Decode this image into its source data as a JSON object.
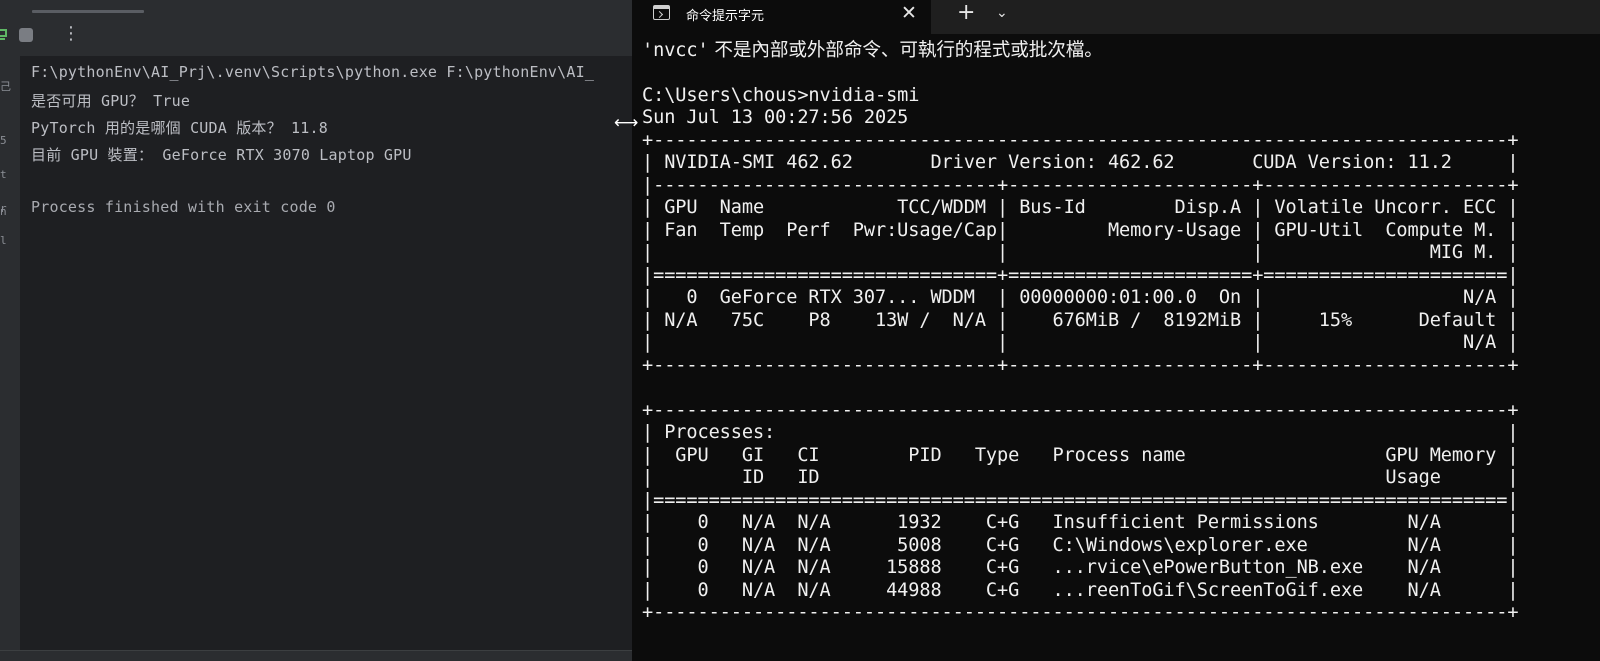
{
  "ide": {
    "gutter_chars": [
      "己",
      "5",
      "t",
      "r",
      "n",
      "l"
    ],
    "console_lines": [
      "F:\\pythonEnv\\AI_Prj\\.venv\\Scripts\\python.exe F:\\pythonEnv\\AI_",
      "是否可用 GPU？ True",
      "PyTorch 用的是哪個 CUDA 版本？ 11.8",
      "目前 GPU 裝置： GeForce RTX 3070 Laptop GPU",
      "",
      "Process finished with exit code 0"
    ],
    "toolbar": {
      "rerun_icon": "rerun-icon",
      "stop_icon": "stop-icon",
      "more_label": "⋮"
    }
  },
  "terminal": {
    "tab_title": "命令提示字元",
    "tab_close": "✕",
    "new_tab": "+",
    "dropdown": "⌄",
    "resize_cursor": "⟷",
    "nvcc_cmd": "'nvcc'",
    "nvcc_msg": " 不是內部或外部命令、可執行的程式或批次檔。",
    "lines": [
      "",
      "C:\\Users\\chous>nvidia-smi",
      "Sun Jul 13 00:27:56 2025",
      "+-----------------------------------------------------------------------------+",
      "| NVIDIA-SMI 462.62       Driver Version: 462.62       CUDA Version: 11.2     |",
      "|-------------------------------+----------------------+----------------------+",
      "| GPU  Name            TCC/WDDM | Bus-Id        Disp.A | Volatile Uncorr. ECC |",
      "| Fan  Temp  Perf  Pwr:Usage/Cap|         Memory-Usage | GPU-Util  Compute M. |",
      "|                               |                      |               MIG M. |",
      "|===============================+======================+======================|",
      "|   0  GeForce RTX 307... WDDM  | 00000000:01:00.0  On |                  N/A |",
      "| N/A   75C    P8    13W /  N/A |    676MiB /  8192MiB |     15%      Default |",
      "|                               |                      |                  N/A |",
      "+-------------------------------+----------------------+----------------------+",
      "",
      "+-----------------------------------------------------------------------------+",
      "| Processes:                                                                  |",
      "|  GPU   GI   CI        PID   Type   Process name                  GPU Memory |",
      "|        ID   ID                                                   Usage      |",
      "|=============================================================================|",
      "|    0   N/A  N/A      1932    C+G   Insufficient Permissions        N/A      |",
      "|    0   N/A  N/A      5008    C+G   C:\\Windows\\explorer.exe         N/A      |",
      "|    0   N/A  N/A     15888    C+G   ...rvice\\ePowerButton_NB.exe    N/A      |",
      "|    0   N/A  N/A     44988    C+G   ...reenToGif\\ScreenToGif.exe    N/A      |",
      "+-----------------------------------------------------------------------------+"
    ]
  }
}
